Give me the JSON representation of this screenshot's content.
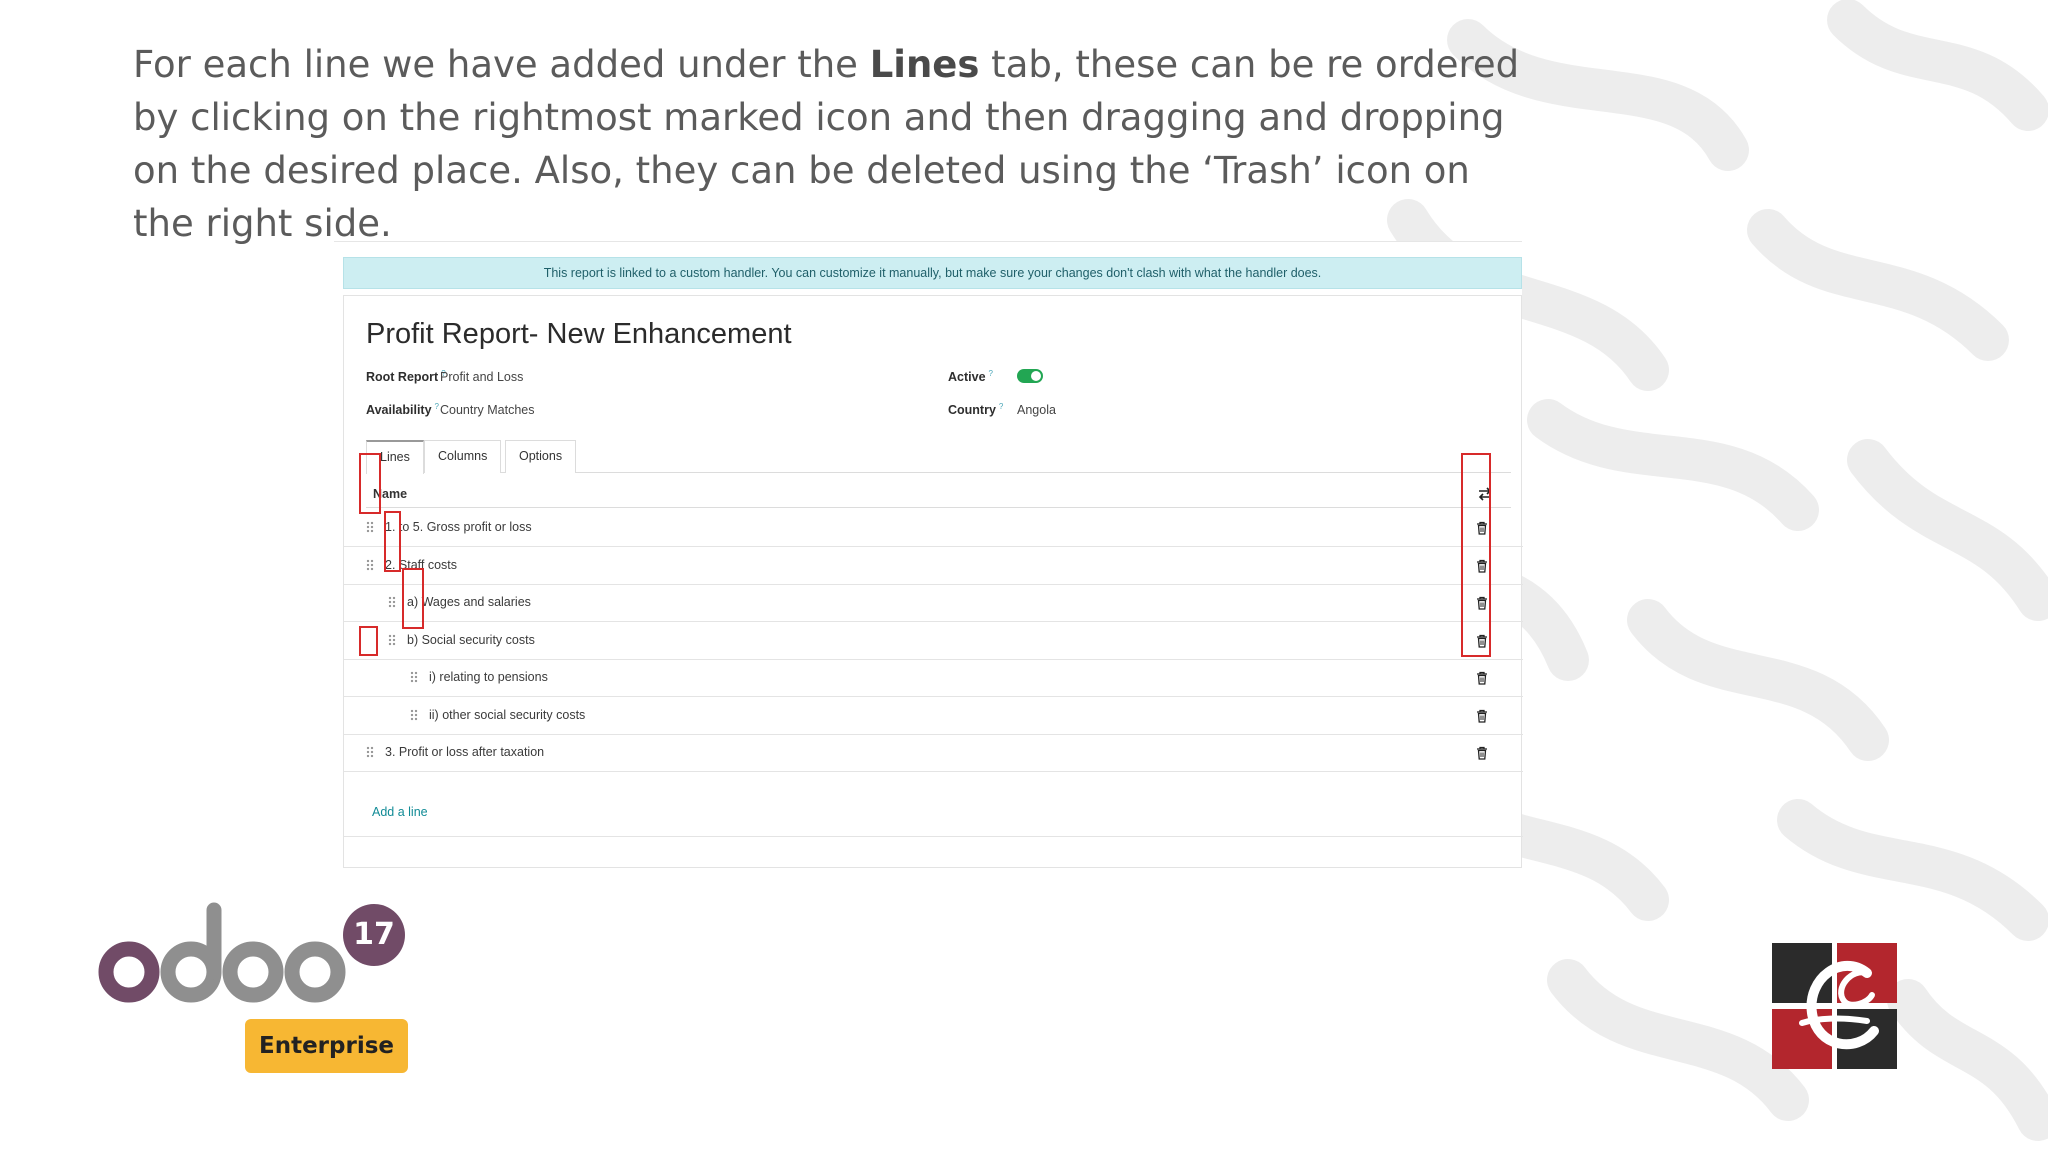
{
  "intro": {
    "part1": "For each line we have added under the ",
    "bold": "Lines",
    "part2": " tab, these can be re ordered by clicking on the rightmost marked icon and then dragging and dropping on the desired place. Also, they can be deleted using the ‘Trash’ icon on the right side."
  },
  "banner": "This report is linked to a custom handler. You can customize it manually, but make sure your changes don't clash with what the handler does.",
  "form": {
    "title": "Profit Report- New Enhancement",
    "root_report_label": "Root Report",
    "root_report_value": "Profit and Loss",
    "availability_label": "Availability",
    "availability_value": "Country Matches",
    "active_label": "Active",
    "active_value": true,
    "country_label": "Country",
    "country_value": "Angola",
    "help_mark": "?"
  },
  "tabs": [
    {
      "label": "Lines",
      "active": true
    },
    {
      "label": "Columns",
      "active": false
    },
    {
      "label": "Options",
      "active": false
    }
  ],
  "table": {
    "header_name": "Name",
    "header_icon": "column-settings-icon",
    "rows": [
      {
        "label": "1. to 5. Gross profit or loss",
        "level": 0
      },
      {
        "label": "2. Staff costs",
        "level": 0
      },
      {
        "label": "a) Wages and salaries",
        "level": 1
      },
      {
        "label": "b) Social security costs",
        "level": 1
      },
      {
        "label": "i) relating to pensions",
        "level": 2
      },
      {
        "label": "ii) other social security costs",
        "level": 2
      },
      {
        "label": "3. Profit or loss after taxation",
        "level": 0
      }
    ],
    "add_line": "Add a line",
    "row_handle_icon": "drag-handle-icon",
    "row_action_icon": "trash-icon"
  },
  "logos": {
    "odoo_text": "odoo",
    "odoo_version": "17",
    "edition": "Enterprise",
    "odoo_color": "#714b67",
    "odoo_grey": "#8f8f8f",
    "edition_color": "#f7b733"
  },
  "colors": {
    "banner_bg": "#cdeef2",
    "highlight_box": "#d72a2a",
    "toggle_on": "#22a653",
    "link": "#118b96"
  }
}
